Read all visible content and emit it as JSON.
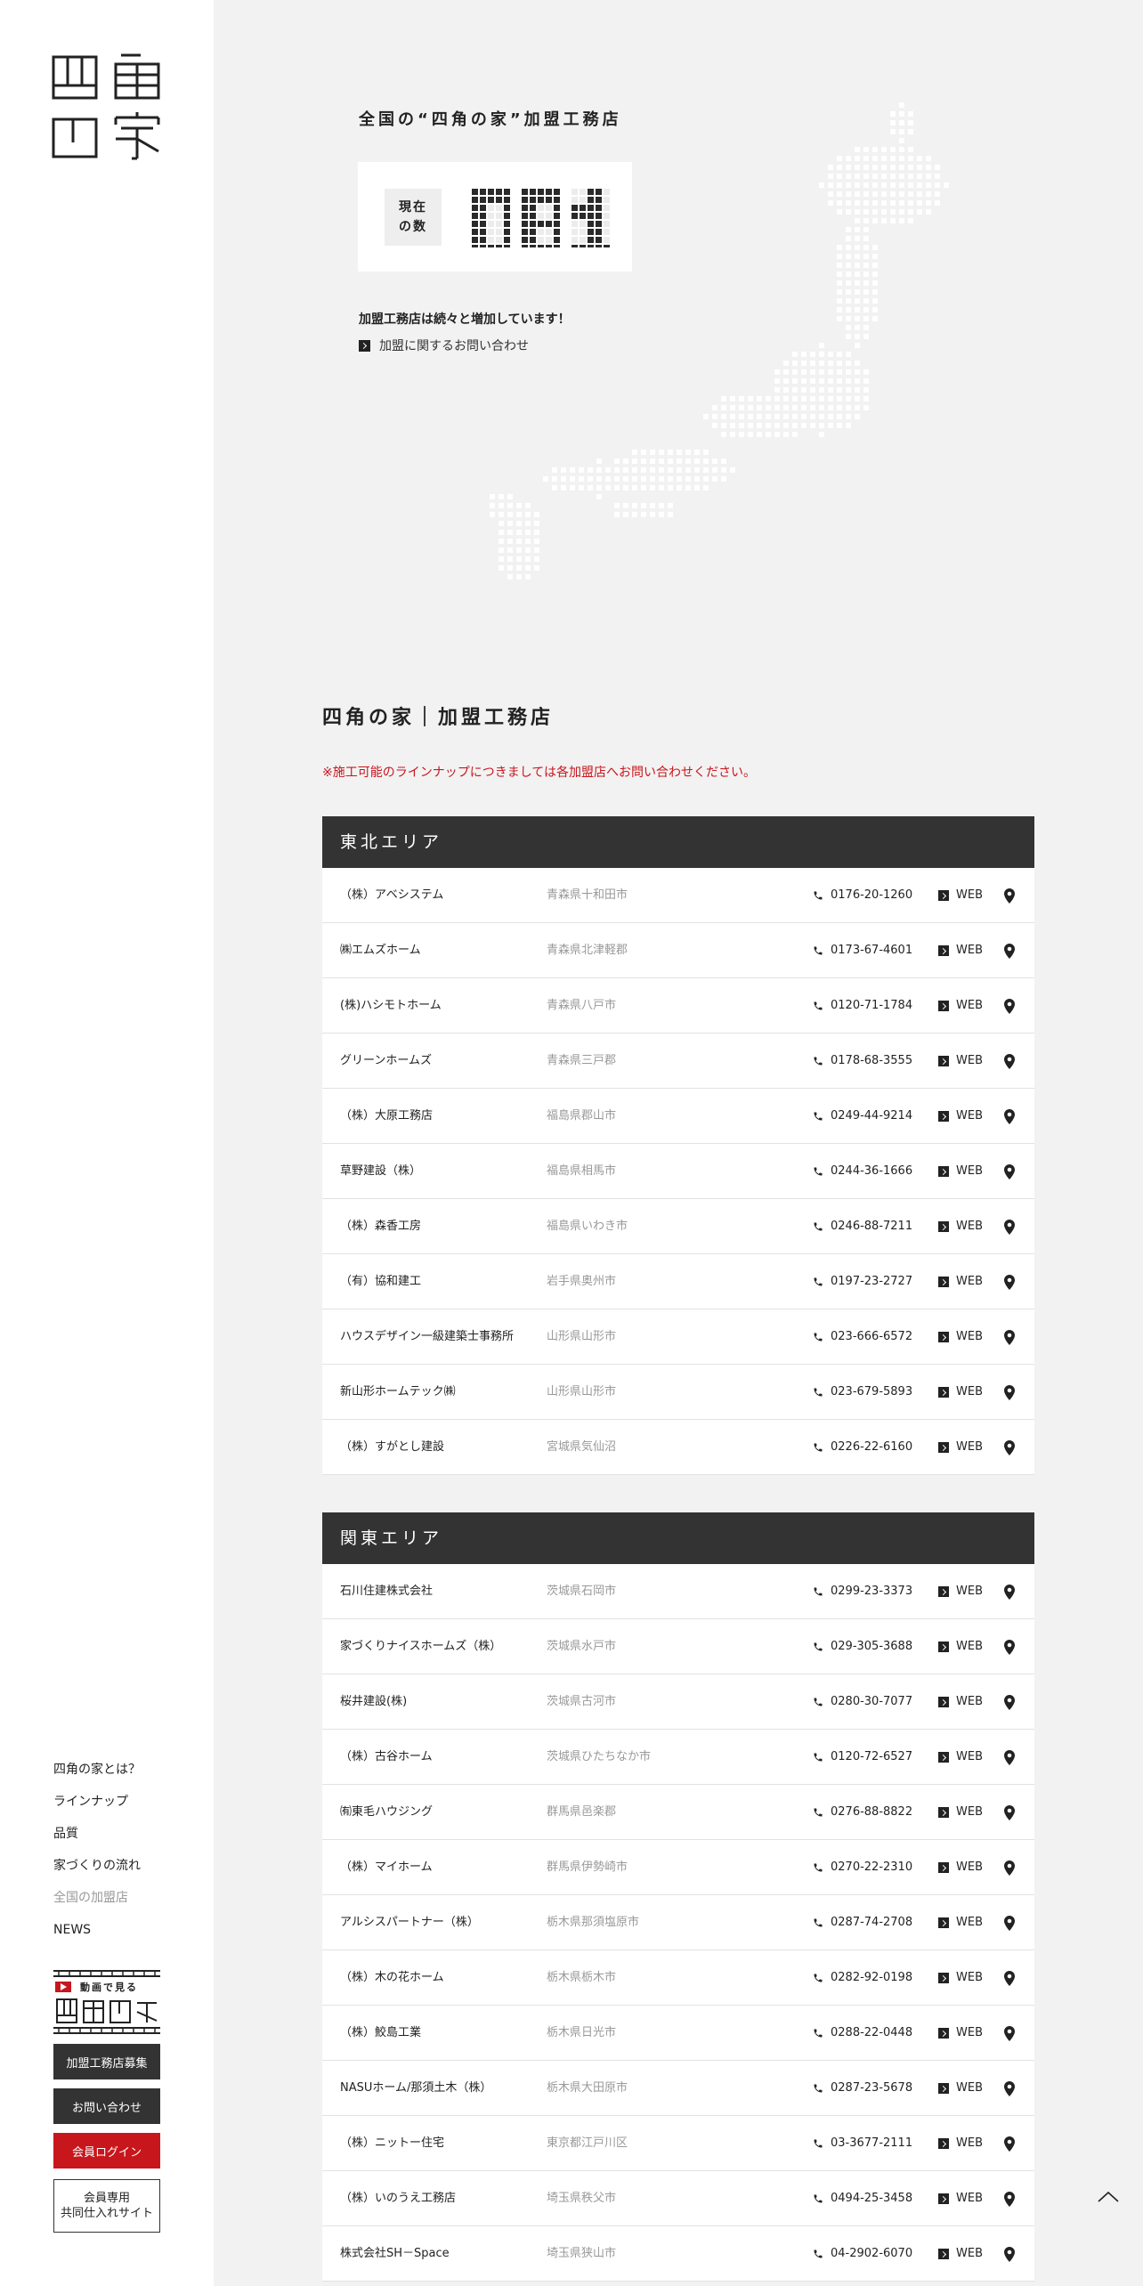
{
  "sidebar": {
    "logo_text": "四角の家",
    "nav": [
      {
        "label": "四角の家とは？",
        "active": false
      },
      {
        "label": "ラインナップ",
        "active": false
      },
      {
        "label": "品質",
        "active": false
      },
      {
        "label": "家づくりの流れ",
        "active": false
      },
      {
        "label": "全国の加盟店",
        "active": true
      },
      {
        "label": "NEWS",
        "active": false
      }
    ],
    "movie_banner": {
      "top_label": "動画で見る",
      "logo_text": "四角の家"
    },
    "recruit_button": "加盟工務店募集",
    "contact_button": "お問い合わせ",
    "login_button": "会員ログイン",
    "member_button": "会員専用\n共同仕入れサイト"
  },
  "hero": {
    "title": "全国の“四角の家”加盟工務店",
    "counter_label": "現在\nの数",
    "counter_value": "081",
    "increase_text": "加盟工務店は続々と増加しています！",
    "inquiry_link": "加盟に関するお問い合わせ"
  },
  "list": {
    "title": "四角の家｜加盟工務店",
    "notice": "※施工可能のラインナップにつきましては各加盟店へお問い合わせください。",
    "web_label": "WEB",
    "areas": [
      {
        "name": "東北エリア",
        "stores": [
          {
            "name": "（株）アベシステム",
            "pref": "青森県十和田市",
            "phone": "0176-20-1260"
          },
          {
            "name": "㈱エムズホーム",
            "pref": "青森県北津軽郡",
            "phone": "0173-67-4601"
          },
          {
            "name": "(株)ハシモトホーム",
            "pref": "青森県八戸市",
            "phone": "0120-71-1784"
          },
          {
            "name": "グリーンホームズ",
            "pref": "青森県三戸郡",
            "phone": "0178-68-3555"
          },
          {
            "name": "（株）大原工務店",
            "pref": "福島県郡山市",
            "phone": "0249-44-9214"
          },
          {
            "name": "草野建設（株）",
            "pref": "福島県相馬市",
            "phone": "0244-36-1666"
          },
          {
            "name": "（株）森香工房",
            "pref": "福島県いわき市",
            "phone": "0246-88-7211"
          },
          {
            "name": "（有）協和建工",
            "pref": "岩手県奥州市",
            "phone": "0197-23-2727"
          },
          {
            "name": "ハウスデザイン一級建築士事務所",
            "pref": "山形県山形市",
            "phone": "023-666-6572"
          },
          {
            "name": "新山形ホームテック㈱",
            "pref": "山形県山形市",
            "phone": "023-679-5893"
          },
          {
            "name": "（株）すがとし建設",
            "pref": "宮城県気仙沼",
            "phone": "0226-22-6160"
          }
        ]
      },
      {
        "name": "関東エリア",
        "stores": [
          {
            "name": "石川住建株式会社",
            "pref": "茨城県石岡市",
            "phone": "0299-23-3373"
          },
          {
            "name": "家づくりナイスホームズ（株）",
            "pref": "茨城県水戸市",
            "phone": "029-305-3688"
          },
          {
            "name": "桜井建設(株)",
            "pref": "茨城県古河市",
            "phone": "0280-30-7077"
          },
          {
            "name": "（株）古谷ホーム",
            "pref": "茨城県ひたちなか市",
            "phone": "0120-72-6527"
          },
          {
            "name": "㈲東毛ハウジング",
            "pref": "群馬県邑楽郡",
            "phone": "0276-88-8822"
          },
          {
            "name": "（株）マイホーム",
            "pref": "群馬県伊勢崎市",
            "phone": "0270-22-2310"
          },
          {
            "name": "アルシスパートナー（株）",
            "pref": "栃木県那須塩原市",
            "phone": "0287-74-2708"
          },
          {
            "name": "（株）木の花ホーム",
            "pref": "栃木県栃木市",
            "phone": "0282-92-0198"
          },
          {
            "name": "（株）鮫島工業",
            "pref": "栃木県日光市",
            "phone": "0288-22-0448"
          },
          {
            "name": "NASUホーム/那須土木（株）",
            "pref": "栃木県大田原市",
            "phone": "0287-23-5678"
          },
          {
            "name": "（株）ニットー住宅",
            "pref": "東京都江戸川区",
            "phone": "03-3677-2111"
          },
          {
            "name": "（株）いのうえ工務店",
            "pref": "埼玉県秩父市",
            "phone": "0494-25-3458"
          },
          {
            "name": "株式会社SH－Space",
            "pref": "埼玉県狭山市",
            "phone": "04-2902-6070"
          }
        ]
      }
    ]
  },
  "colors": {
    "accent_red": "#c8161d",
    "dark": "#333333",
    "background": "#f2f2f2"
  }
}
